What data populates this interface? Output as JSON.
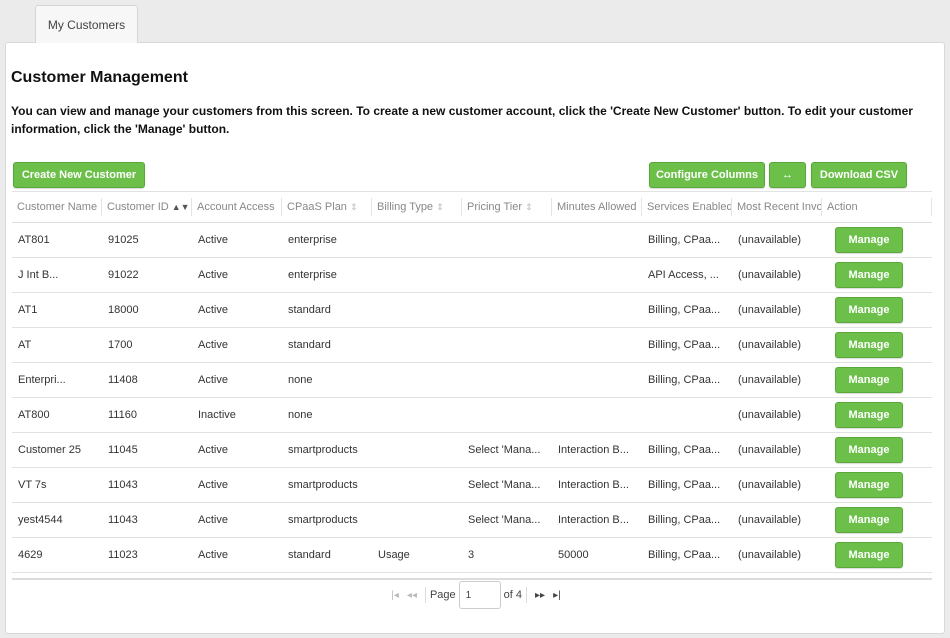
{
  "tab": {
    "label": "My Customers"
  },
  "page": {
    "title": "Customer Management",
    "description": "You can view and manage your customers from this screen. To create a new customer account, click the 'Create New Customer' button. To edit your customer information, click the 'Manage' button."
  },
  "toolbar": {
    "create_label": "Create New Customer",
    "configure_label": "Configure Columns",
    "expand_label": "↔",
    "download_label": "Download CSV"
  },
  "table": {
    "headers": [
      "Customer Name",
      "Customer ID",
      "Account Access",
      "CPaaS Plan",
      "Billing Type",
      "Pricing Tier",
      "Minutes Allowed",
      "Services Enabled",
      "Most Recent Invoice",
      "Action"
    ],
    "rows": [
      {
        "name": "AT801",
        "id": "91025",
        "access": "Active",
        "plan": "enterprise",
        "billing": "",
        "tier": "",
        "minutes": "",
        "services": "Billing, CPaa...",
        "invoice": "(unavailable)",
        "action": "Manage"
      },
      {
        "name": "J  Int B...",
        "id": "91022",
        "access": "Active",
        "plan": "enterprise",
        "billing": "",
        "tier": "",
        "minutes": "",
        "services": "API Access, ...",
        "invoice": "(unavailable)",
        "action": "Manage"
      },
      {
        "name": "AT1",
        "id": "18000",
        "access": "Active",
        "plan": "standard",
        "billing": "",
        "tier": "",
        "minutes": "",
        "services": "Billing, CPaa...",
        "invoice": "(unavailable)",
        "action": "Manage"
      },
      {
        "name": "AT",
        "id": "1700",
        "access": "Active",
        "plan": "standard",
        "billing": "",
        "tier": "",
        "minutes": "",
        "services": "Billing, CPaa...",
        "invoice": "(unavailable)",
        "action": "Manage"
      },
      {
        "name": "Enterpri...",
        "id": "11408",
        "access": "Active",
        "plan": "none",
        "billing": "",
        "tier": "",
        "minutes": "",
        "services": "Billing, CPaa...",
        "invoice": "(unavailable)",
        "action": "Manage"
      },
      {
        "name": "AT800",
        "id": "11160",
        "access": "Inactive",
        "plan": "none",
        "billing": "",
        "tier": "",
        "minutes": "",
        "services": "",
        "invoice": "(unavailable)",
        "action": "Manage"
      },
      {
        "name": "Customer 25",
        "id": "11045",
        "access": "Active",
        "plan": "smartproducts",
        "billing": "",
        "tier": "Select 'Mana...",
        "minutes": "Interaction B...",
        "services": "Billing, CPaa...",
        "invoice": "(unavailable)",
        "action": "Manage"
      },
      {
        "name": "VT 7s",
        "id": "11043",
        "access": "Active",
        "plan": "smartproducts",
        "billing": "",
        "tier": "Select 'Mana...",
        "minutes": "Interaction B...",
        "services": "Billing, CPaa...",
        "invoice": "(unavailable)",
        "action": "Manage"
      },
      {
        "name": "yest4544",
        "id": "11043",
        "access": "Active",
        "plan": "smartproducts",
        "billing": "",
        "tier": "Select 'Mana...",
        "minutes": "Interaction B...",
        "services": "Billing, CPaa...",
        "invoice": "(unavailable)",
        "action": "Manage"
      },
      {
        "name": "4629",
        "id": "11023",
        "access": "Active",
        "plan": "standard",
        "billing": "Usage",
        "tier": "3",
        "minutes": "50000",
        "services": "Billing, CPaa...",
        "invoice": "(unavailable)",
        "action": "Manage"
      }
    ]
  },
  "pagination": {
    "page_label": "Page",
    "current_page": "1",
    "of_label": "of 4"
  },
  "colors": {
    "accent_green": "#6cc04a",
    "background": "#ebebeb"
  }
}
